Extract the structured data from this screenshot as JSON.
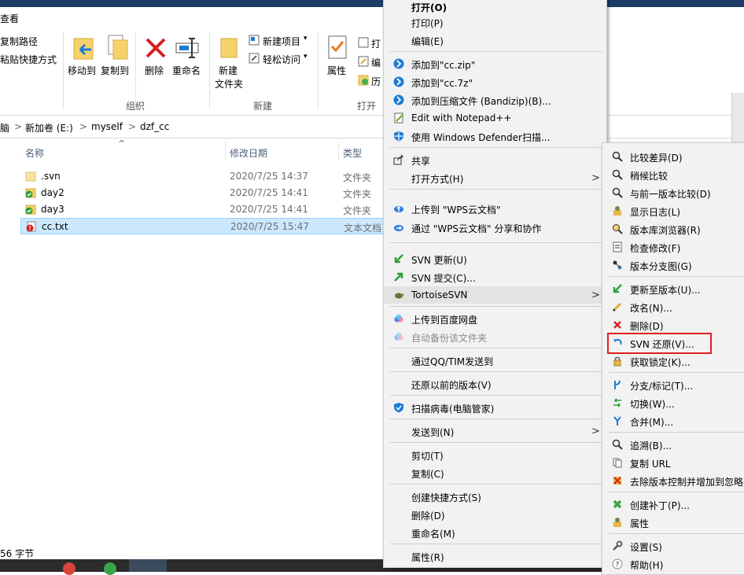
{
  "ribbon": {
    "tab_view": "查看",
    "copy_path": "复制路径",
    "paste_shortcut": "粘贴快捷方式",
    "move_to": "移动到",
    "copy_to": "复制到",
    "delete": "删除",
    "rename": "重命名",
    "new_folder_line1": "新建",
    "new_folder_line2": "文件夹",
    "new_item": "新建项目",
    "easy_access": "轻松访问",
    "properties": "属性",
    "open_short": "打",
    "edit_short": "编",
    "history_short": "历",
    "group_organize": "组织",
    "group_new": "新建",
    "group_open": "打开"
  },
  "address": {
    "crumb0": "脑",
    "crumb1": "新加卷 (E:)",
    "crumb2": "myself",
    "crumb3": "dzf_cc",
    "sep": ">"
  },
  "list": {
    "col_name": "名称",
    "col_date": "修改日期",
    "col_type": "类型",
    "sort_arrow": "^",
    "rows": [
      {
        "name": ".svn",
        "date": "2020/7/25 14:37",
        "type": "文件夹"
      },
      {
        "name": "day2",
        "date": "2020/7/25 14:41",
        "type": "文件夹"
      },
      {
        "name": "day3",
        "date": "2020/7/25 14:41",
        "type": "文件夹"
      },
      {
        "name": "cc.txt",
        "date": "2020/7/25 15:47",
        "type": "文本文档"
      }
    ]
  },
  "status": {
    "text": "56 字节"
  },
  "main_menu": {
    "items": [
      {
        "label": "打开(O)"
      },
      {
        "label": "打印(P)"
      },
      {
        "label": "编辑(E)"
      },
      {
        "label": "添加到\"cc.zip\""
      },
      {
        "label": "添加到\"cc.7z\""
      },
      {
        "label": "添加到压缩文件 (Bandizip)(B)..."
      },
      {
        "label": "Edit with Notepad++"
      },
      {
        "label": "使用 Windows Defender扫描..."
      },
      {
        "label": "共享"
      },
      {
        "label": "打开方式(H)"
      },
      {
        "label": "上传到 \"WPS云文档\""
      },
      {
        "label": "通过 \"WPS云文档\" 分享和协作"
      },
      {
        "label": "SVN 更新(U)"
      },
      {
        "label": "SVN 提交(C)..."
      },
      {
        "label": "TortoiseSVN"
      },
      {
        "label": "上传到百度网盘"
      },
      {
        "label": "自动备份该文件夹"
      },
      {
        "label": "通过QQ/TIM发送到"
      },
      {
        "label": "还原以前的版本(V)"
      },
      {
        "label": "扫描病毒(电脑管家)"
      },
      {
        "label": "发送到(N)"
      },
      {
        "label": "剪切(T)"
      },
      {
        "label": "复制(C)"
      },
      {
        "label": "创建快捷方式(S)"
      },
      {
        "label": "删除(D)"
      },
      {
        "label": "重命名(M)"
      },
      {
        "label": "属性(R)"
      }
    ],
    "submenu_arrow": ">"
  },
  "svn_menu": {
    "items": [
      {
        "label": "比较差异(D)"
      },
      {
        "label": "稍候比较"
      },
      {
        "label": "与前一版本比较(D)"
      },
      {
        "label": "显示日志(L)"
      },
      {
        "label": "版本库浏览器(R)"
      },
      {
        "label": "检查修改(F)"
      },
      {
        "label": "版本分支图(G)"
      },
      {
        "label": "更新至版本(U)..."
      },
      {
        "label": "改名(N)..."
      },
      {
        "label": "删除(D)"
      },
      {
        "label": "SVN 还原(V)..."
      },
      {
        "label": "获取锁定(K)..."
      },
      {
        "label": "分支/标记(T)..."
      },
      {
        "label": "切换(W)..."
      },
      {
        "label": "合并(M)..."
      },
      {
        "label": "追溯(B)..."
      },
      {
        "label": "复制 URL"
      },
      {
        "label": "去除版本控制并增加到忽略"
      },
      {
        "label": "创建补丁(P)..."
      },
      {
        "label": "属性"
      },
      {
        "label": "设置(S)"
      },
      {
        "label": "帮助(H)"
      }
    ]
  },
  "colors": {
    "highlight_box": "#e02020",
    "selection": "#cce8ff",
    "menu_bg": "#f2f2f2"
  }
}
